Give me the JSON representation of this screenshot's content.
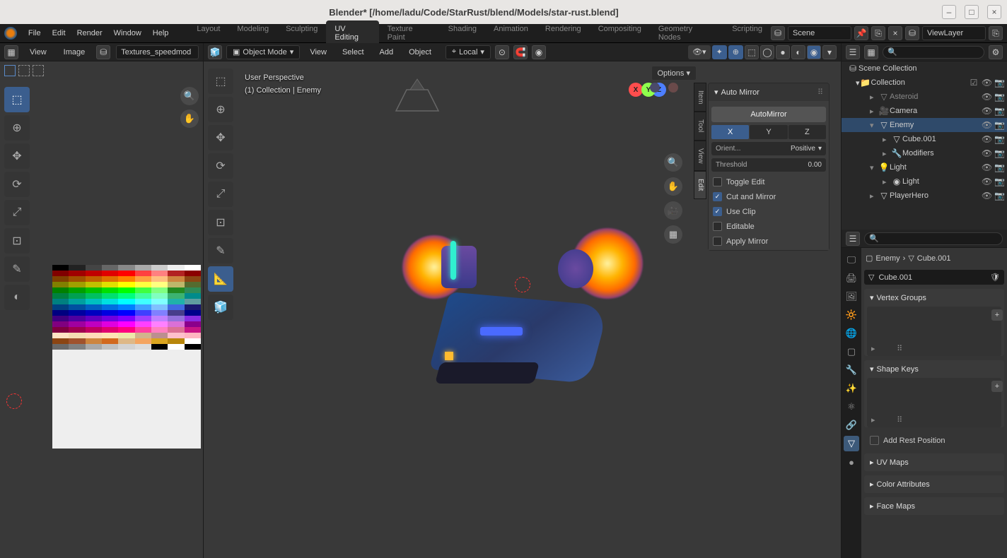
{
  "titlebar": {
    "title": "Blender* [/home/ladu/Code/StarRust/blend/Models/star-rust.blend]"
  },
  "menubar": {
    "items": [
      "File",
      "Edit",
      "Render",
      "Window",
      "Help"
    ]
  },
  "workspaces": {
    "tabs": [
      "Layout",
      "Modeling",
      "Sculpting",
      "UV Editing",
      "Texture Paint",
      "Shading",
      "Animation",
      "Rendering",
      "Compositing",
      "Geometry Nodes",
      "Scripting"
    ],
    "active": "UV Editing"
  },
  "scene": {
    "label": "Scene",
    "viewlayer": "ViewLayer"
  },
  "uv": {
    "menus": [
      "View",
      "Image"
    ],
    "image_name": "Textures_speedmod"
  },
  "viewport": {
    "mode": "Object Mode",
    "menus": [
      "View",
      "Select",
      "Add",
      "Object"
    ],
    "orientation": "Local",
    "options": "Options",
    "info_line1": "User Perspective",
    "info_line2": "(1) Collection | Enemy"
  },
  "auto_mirror": {
    "title": "Auto Mirror",
    "execute": "AutoMirror",
    "axes": [
      "X",
      "Y",
      "Z"
    ],
    "active_axis": "X",
    "orient_label": "Orient...",
    "orient_value": "Positive",
    "threshold_label": "Threshold",
    "threshold_value": "0.00",
    "checks": {
      "toggle_edit": "Toggle Edit",
      "cut_mirror": "Cut and Mirror",
      "use_clip": "Use Clip",
      "editable": "Editable",
      "apply_mirror": "Apply Mirror"
    }
  },
  "side_tabs": [
    "Item",
    "Tool",
    "View",
    "Edit"
  ],
  "outliner": {
    "root": "Scene Collection",
    "collection": "Collection",
    "items": [
      {
        "name": "Asteroid",
        "dim": true,
        "indent": 36,
        "icon": "▽"
      },
      {
        "name": "Camera",
        "dim": false,
        "indent": 36,
        "icon": "🎥"
      },
      {
        "name": "Enemy",
        "dim": false,
        "indent": 36,
        "icon": "▽",
        "selected": true
      },
      {
        "name": "Cube.001",
        "dim": false,
        "indent": 54,
        "icon": "▽"
      },
      {
        "name": "Modifiers",
        "dim": false,
        "indent": 54,
        "icon": "🔧"
      },
      {
        "name": "Light",
        "dim": false,
        "indent": 36,
        "icon": "💡"
      },
      {
        "name": "Light",
        "dim": false,
        "indent": 54,
        "icon": "◉"
      },
      {
        "name": "PlayerHero",
        "dim": false,
        "indent": 36,
        "icon": "▽"
      }
    ]
  },
  "properties": {
    "breadcrumb_obj": "Enemy",
    "breadcrumb_data": "Cube.001",
    "name_value": "Cube.001",
    "sections": {
      "vertex_groups": "Vertex Groups",
      "shape_keys": "Shape Keys",
      "add_rest": "Add Rest Position",
      "uv_maps": "UV Maps",
      "color_attrs": "Color Attributes",
      "face_maps": "Face Maps"
    }
  }
}
